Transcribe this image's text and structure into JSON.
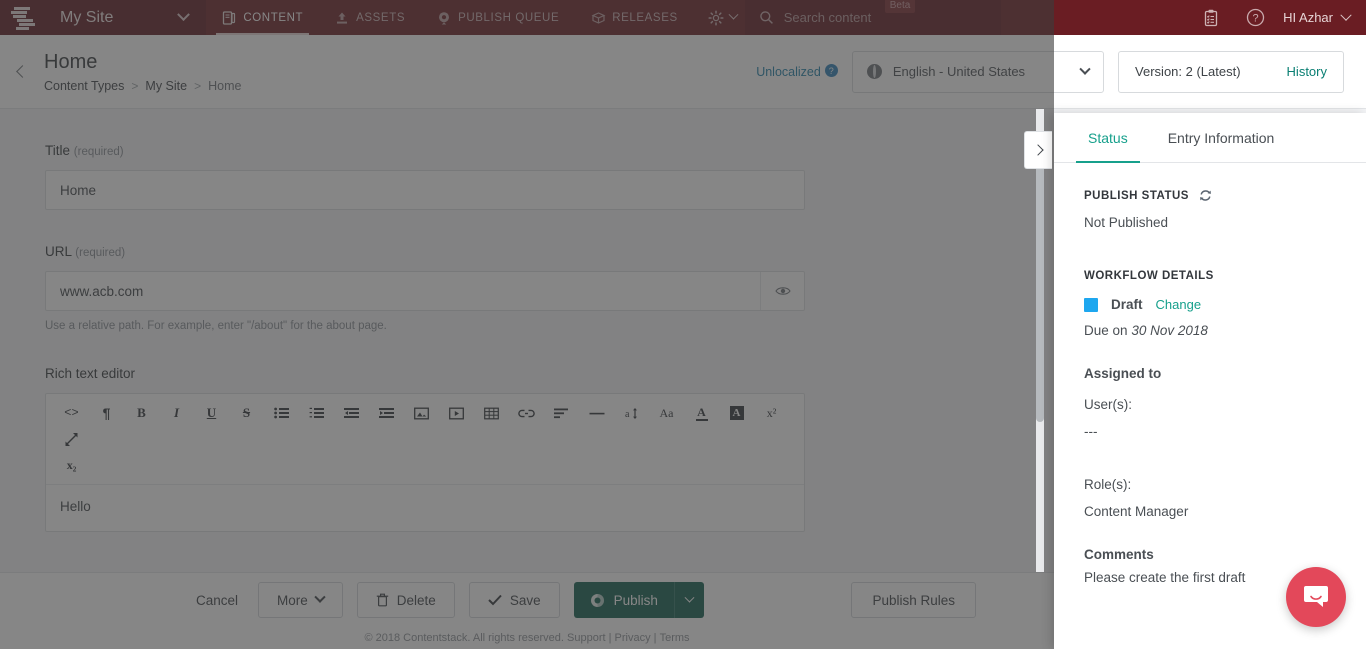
{
  "topnav": {
    "logo": "contentstack-logo",
    "site_name": "My Site",
    "items": [
      {
        "label": "CONTENT",
        "icon": "content-icon",
        "active": true
      },
      {
        "label": "ASSETS",
        "icon": "assets-upload-icon",
        "active": false
      },
      {
        "label": "PUBLISH QUEUE",
        "icon": "publish-queue-icon",
        "active": false
      },
      {
        "label": "RELEASES",
        "icon": "releases-box-icon",
        "active": false
      }
    ],
    "settings_icon": "gear-icon",
    "search_placeholder": "Search content",
    "beta_badge": "Beta",
    "tasks_icon": "clipboard-icon",
    "help_icon": "help-circle-icon",
    "user_greeting": "HI  Azhar",
    "bg_color": "#6a1d23"
  },
  "header": {
    "back_icon": "back-chevron-icon",
    "title": "Home",
    "breadcrumb": [
      "Content Types",
      "My Site",
      "Home"
    ],
    "breadcrumb_separator": ">",
    "unlocalized_label": "Unlocalized",
    "unlocalized_help": "?",
    "locale": "English - United States",
    "version_label": "Version: 2 (Latest)",
    "history_label": "History",
    "history_color": "#0a7f73"
  },
  "form": {
    "fields": [
      {
        "label": "Title",
        "required_note": "(required)",
        "value": "Home"
      },
      {
        "label": "URL",
        "required_note": "(required)",
        "value": "www.acb.com",
        "hint": "Use a relative path. For example, enter \"/about\" for the about page.",
        "trailing_icon": "eye-icon"
      }
    ],
    "rte": {
      "label": "Rich text editor",
      "toolbar": [
        {
          "name": "source-code-icon",
          "glyph": "<>"
        },
        {
          "name": "paragraph-icon",
          "glyph": "¶"
        },
        {
          "name": "bold-icon",
          "glyph": "B"
        },
        {
          "name": "italic-icon",
          "glyph": "I"
        },
        {
          "name": "underline-icon",
          "glyph": "U"
        },
        {
          "name": "strikethrough-icon",
          "glyph": "S"
        },
        {
          "name": "bulleted-list-icon",
          "glyph": "list-ul"
        },
        {
          "name": "numbered-list-icon",
          "glyph": "list-ol"
        },
        {
          "name": "outdent-icon",
          "glyph": "outdent"
        },
        {
          "name": "indent-icon",
          "glyph": "indent"
        },
        {
          "name": "insert-image-icon",
          "glyph": "image"
        },
        {
          "name": "insert-video-icon",
          "glyph": "video"
        },
        {
          "name": "insert-table-icon",
          "glyph": "table"
        },
        {
          "name": "insert-link-icon",
          "glyph": "link"
        },
        {
          "name": "align-icon",
          "glyph": "align"
        },
        {
          "name": "horizontal-rule-icon",
          "glyph": "—"
        },
        {
          "name": "line-height-icon",
          "glyph": "a↕"
        },
        {
          "name": "font-size-icon",
          "glyph": "Aa"
        },
        {
          "name": "text-color-icon",
          "glyph": "A"
        },
        {
          "name": "highlight-color-icon",
          "glyph": "A"
        },
        {
          "name": "superscript-icon",
          "glyph": "x²"
        },
        {
          "name": "fullscreen-icon",
          "glyph": "expand"
        },
        {
          "name": "subscript-icon",
          "glyph": "x₂"
        }
      ],
      "content": "Hello"
    }
  },
  "edge_toggle": {
    "icon": "chevron-right-icon"
  },
  "actionbar": {
    "cancel_label": "Cancel",
    "more_label": "More",
    "delete_label": "Delete",
    "delete_icon": "trash-icon",
    "save_label": "Save",
    "save_icon": "check-icon",
    "publish_label": "Publish",
    "publish_icon": "publish-globe-icon",
    "publish_caret_icon": "chevron-down-icon",
    "publish_color": "#0f5c4d",
    "publish_rules_label": "Publish Rules"
  },
  "footer": {
    "copyright": "© 2018 Contentstack. All rights reserved.",
    "links": [
      "Support",
      "Privacy",
      "Terms"
    ],
    "separator": "|"
  },
  "drawer": {
    "tabs": [
      {
        "label": "Status",
        "active": true
      },
      {
        "label": "Entry Information",
        "active": false
      }
    ],
    "active_tab_color": "#17a08c",
    "publish_status": {
      "heading": "PUBLISH STATUS",
      "refresh_icon": "refresh-icon",
      "value": "Not Published"
    },
    "workflow": {
      "heading": "WORKFLOW DETAILS",
      "stage_color": "#1ea7ef",
      "stage_name": "Draft",
      "change_label": "Change",
      "due_prefix": "Due on",
      "due_date": "30 Nov 2018",
      "assigned_heading": "Assigned to",
      "users_label": "User(s):",
      "users_value": "---",
      "roles_label": "Role(s):",
      "roles_value": "Content Manager",
      "comments_heading": "Comments",
      "comments_value": "Please create the first draft"
    }
  },
  "intercom": {
    "icon": "messenger-icon",
    "color": "#e3485a"
  }
}
